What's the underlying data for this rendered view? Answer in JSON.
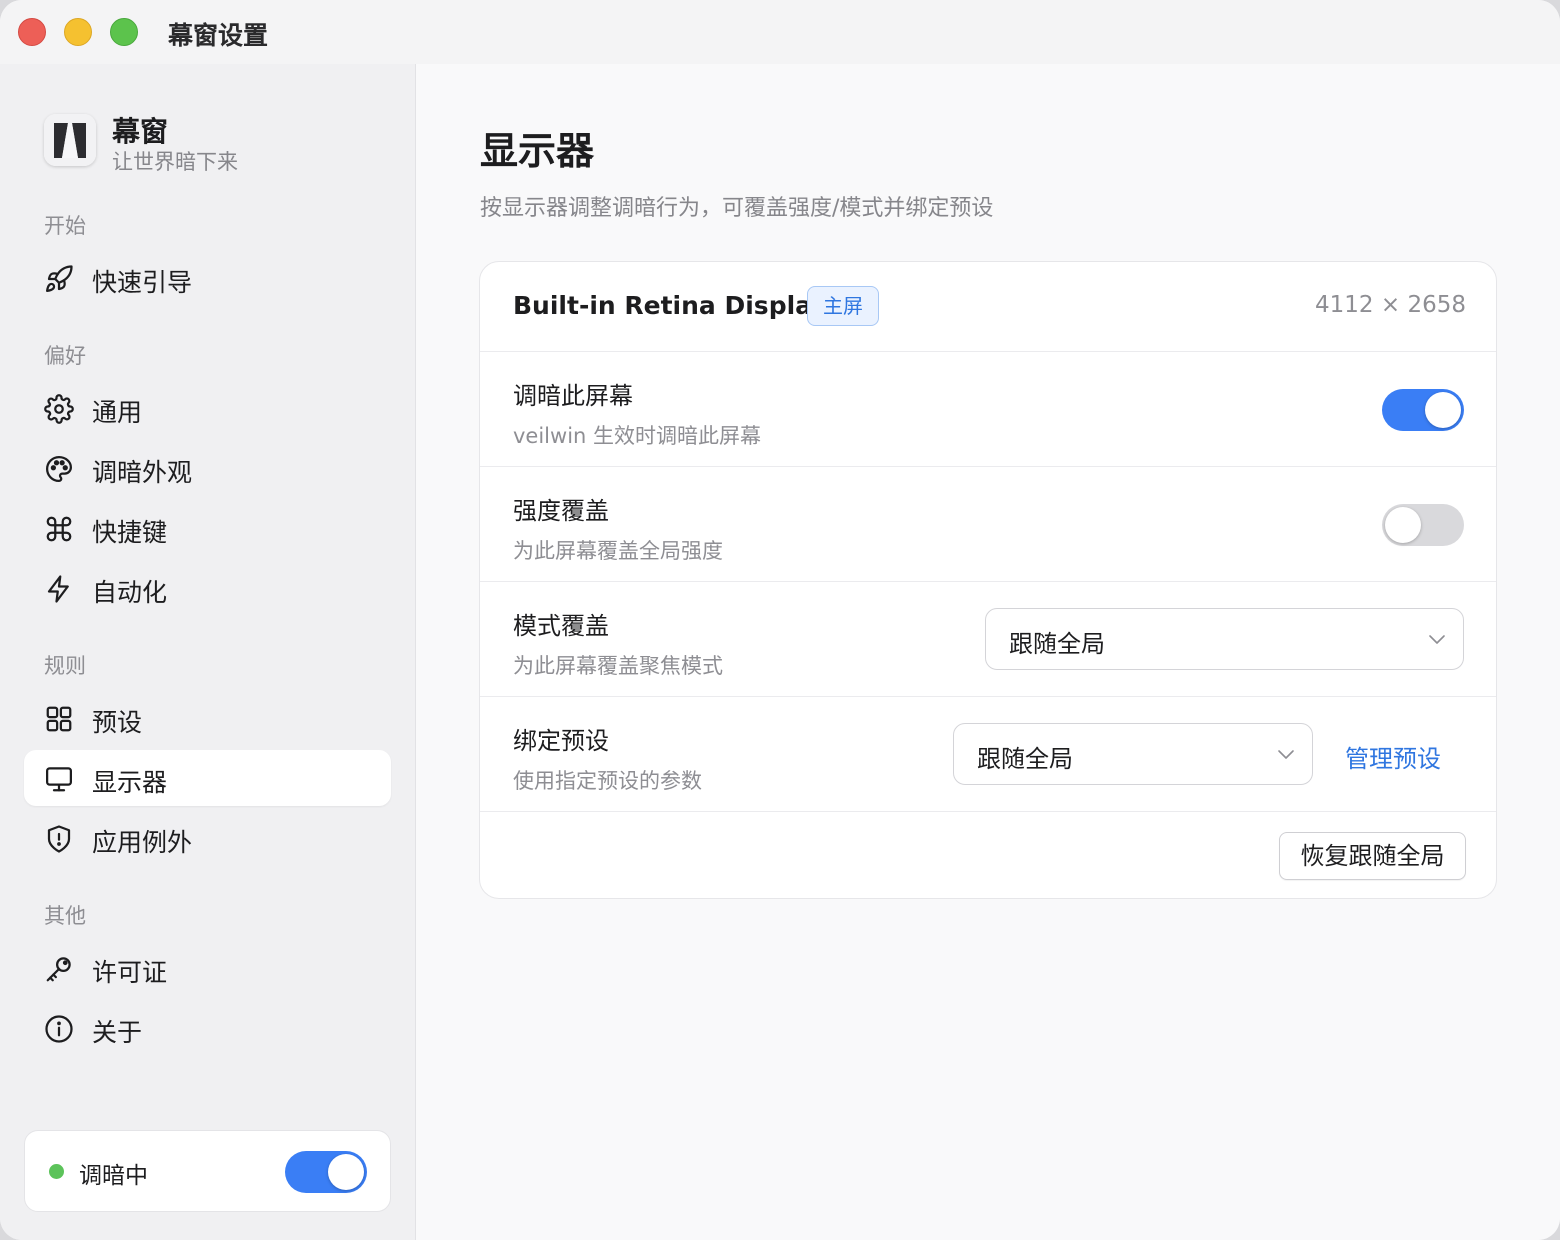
{
  "window": {
    "title": "幕窗设置"
  },
  "app": {
    "name": "幕窗",
    "tagline": "让世界暗下来",
    "icon": "app-logo-icon"
  },
  "sidebar": {
    "sections": [
      {
        "label": "开始"
      },
      {
        "label": "偏好"
      },
      {
        "label": "规则"
      },
      {
        "label": "其他"
      }
    ],
    "items": [
      {
        "label": "快速引导",
        "icon": "rocket-icon"
      },
      {
        "label": "通用",
        "icon": "gear-icon"
      },
      {
        "label": "调暗外观",
        "icon": "palette-icon"
      },
      {
        "label": "快捷键",
        "icon": "command-icon"
      },
      {
        "label": "自动化",
        "icon": "lightning-icon"
      },
      {
        "label": "预设",
        "icon": "grid-icon"
      },
      {
        "label": "显示器",
        "icon": "monitor-icon",
        "active": true
      },
      {
        "label": "应用例外",
        "icon": "shield-icon"
      },
      {
        "label": "许可证",
        "icon": "key-icon"
      },
      {
        "label": "关于",
        "icon": "info-icon"
      }
    ],
    "status": {
      "text": "调暗中",
      "enabled": true,
      "dot_color": "#5cc35a"
    }
  },
  "main": {
    "title": "显示器",
    "subtitle": "按显示器调整调暗行为，可覆盖强度/模式并绑定预设",
    "display": {
      "name": "Built-in Retina Display",
      "badge": "主屏",
      "resolution": "4112 × 2658",
      "rows": [
        {
          "title": "调暗此屏幕",
          "desc": "veilwin 生效时调暗此屏幕",
          "toggle_on": true
        },
        {
          "title": "强度覆盖",
          "desc": "为此屏幕覆盖全局强度",
          "toggle_on": false
        },
        {
          "title": "模式覆盖",
          "desc": "为此屏幕覆盖聚焦模式",
          "select_value": "跟随全局"
        },
        {
          "title": "绑定预设",
          "desc": "使用指定预设的参数",
          "select_value": "跟随全局",
          "link": "管理预设"
        }
      ],
      "reset_button": "恢复跟随全局"
    }
  },
  "colors": {
    "accent": "#3a7ef5",
    "link": "#2f76e0",
    "toggle_off": "#d9d9dc"
  }
}
